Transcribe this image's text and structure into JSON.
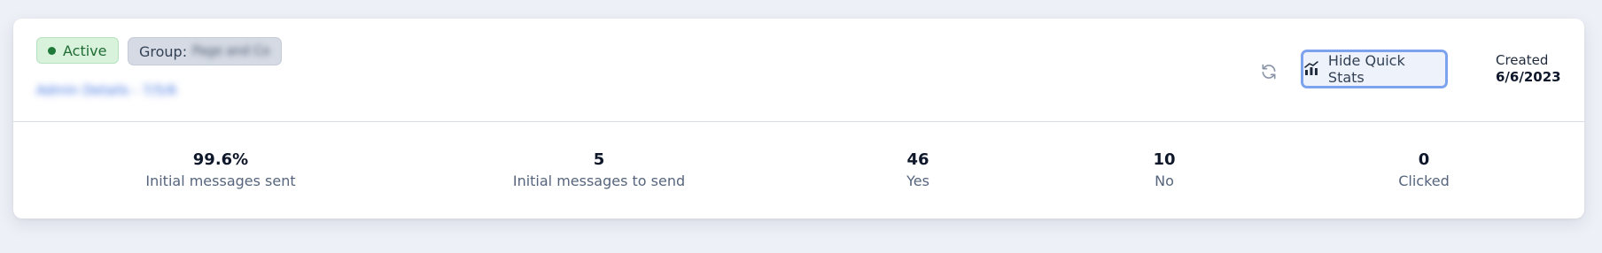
{
  "campaign": {
    "status": "Active",
    "group_label": "Group:",
    "group_name": "Page and Co",
    "sub_link": "Admin Details - 7/5/6"
  },
  "actions": {
    "refresh_icon": "refresh-icon",
    "quick_stats_label": "Hide Quick Stats",
    "quick_stats_icon": "bar-chart-icon"
  },
  "created": {
    "label": "Created",
    "date": "6/6/2023"
  },
  "stats": [
    {
      "value": "99.6%",
      "label": "Initial messages sent"
    },
    {
      "value": "5",
      "label": "Initial messages to send"
    },
    {
      "value": "46",
      "label": "Yes"
    },
    {
      "value": "10",
      "label": "No"
    },
    {
      "value": "0",
      "label": "Clicked"
    }
  ],
  "colors": {
    "active_green": "#1f7a3a",
    "accent_blue": "#7ea3ee",
    "background": "#edf0f7"
  }
}
